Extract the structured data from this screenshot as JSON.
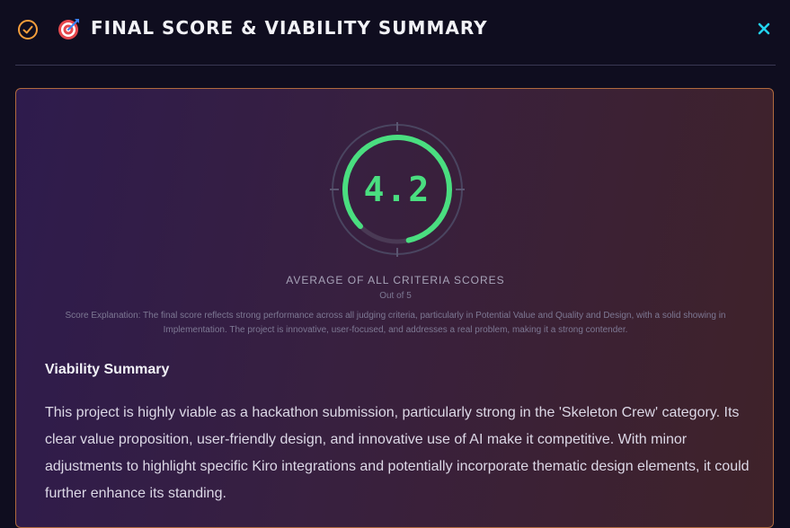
{
  "header": {
    "title": "FINAL SCORE & VIABILITY SUMMARY",
    "icons": [
      "check-circle-icon",
      "target-icon",
      "close-icon"
    ],
    "accent_color": "#f59e3b",
    "close_color": "#22d3ee"
  },
  "score": {
    "value": "4.2",
    "max": 5,
    "fraction": 0.84,
    "color": "#4ade80",
    "label": "AVERAGE OF ALL CRITERIA SCORES",
    "out_of": "Out of 5",
    "explanation": "Score Explanation: The final score reflects strong performance across all judging criteria, particularly in Potential Value and Quality and Design, with a solid showing in Implementation. The project is innovative, user-focused, and addresses a real problem, making it a strong contender."
  },
  "viability": {
    "title": "Viability Summary",
    "body": "This project is highly viable as a hackathon submission, particularly strong in the 'Skeleton Crew' category. Its clear value proposition, user-friendly design, and innovative use of AI make it competitive. With minor adjustments to highlight specific Kiro integrations and potentially incorporate thematic design elements, it could further enhance its standing."
  }
}
